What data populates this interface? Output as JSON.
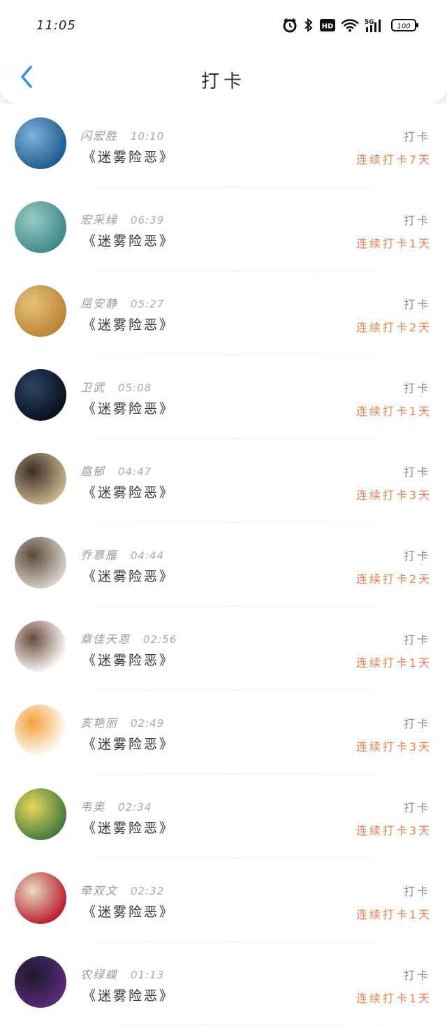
{
  "status": {
    "time": "11:05",
    "battery": "100"
  },
  "header": {
    "title": "打卡"
  },
  "rows": [
    {
      "name": "闪宏胜",
      "time": "10:10",
      "book": "《迷雾险恶》",
      "tag": "打卡",
      "streak": "连续打卡7天",
      "av": [
        "#1d5a8f",
        "#7fb3d9"
      ]
    },
    {
      "name": "宏采绿",
      "time": "06:39",
      "book": "《迷雾险恶》",
      "tag": "打卡",
      "streak": "连续打卡1天",
      "av": [
        "#3c8a8a",
        "#9cc9c4"
      ]
    },
    {
      "name": "屈安静",
      "time": "05:27",
      "book": "《迷雾险恶》",
      "tag": "打卡",
      "streak": "连续打卡2天",
      "av": [
        "#b98434",
        "#e6c27a"
      ]
    },
    {
      "name": "卫武",
      "time": "05:08",
      "book": "《迷雾险恶》",
      "tag": "打卡",
      "streak": "连续打卡1天",
      "av": [
        "#0a0f1a",
        "#2a4466"
      ]
    },
    {
      "name": "扈郁",
      "time": "04:47",
      "book": "《迷雾险恶》",
      "tag": "打卡",
      "streak": "连续打卡3天",
      "av": [
        "#c9b48a",
        "#3a2f2a"
      ]
    },
    {
      "name": "乔慕雁",
      "time": "04:44",
      "book": "《迷雾险恶》",
      "tag": "打卡",
      "streak": "连续打卡2天",
      "av": [
        "#d8d2cc",
        "#5b4a3a"
      ]
    },
    {
      "name": "章佳天恩",
      "time": "02:56",
      "book": "《迷雾险恶》",
      "tag": "打卡",
      "streak": "连续打卡1天",
      "av": [
        "#ffffff",
        "#6b4a3a"
      ]
    },
    {
      "name": "亥艳丽",
      "time": "02:49",
      "book": "《迷雾险恶》",
      "tag": "打卡",
      "streak": "连续打卡3天",
      "av": [
        "#ffffff",
        "#f2a23c"
      ]
    },
    {
      "name": "韦奥",
      "time": "02:34",
      "book": "《迷雾险恶》",
      "tag": "打卡",
      "streak": "连续打卡3天",
      "av": [
        "#3f7a3a",
        "#e8d85a"
      ]
    },
    {
      "name": "牵双文",
      "time": "02:32",
      "book": "《迷雾险恶》",
      "tag": "打卡",
      "streak": "连续打卡1天",
      "av": [
        "#b81e2a",
        "#e9d9c6"
      ]
    },
    {
      "name": "农绿蝶",
      "time": "01:13",
      "book": "《迷雾险恶》",
      "tag": "打卡",
      "streak": "连续打卡1天",
      "av": [
        "#5a2a7a",
        "#1a1a2a"
      ]
    }
  ]
}
